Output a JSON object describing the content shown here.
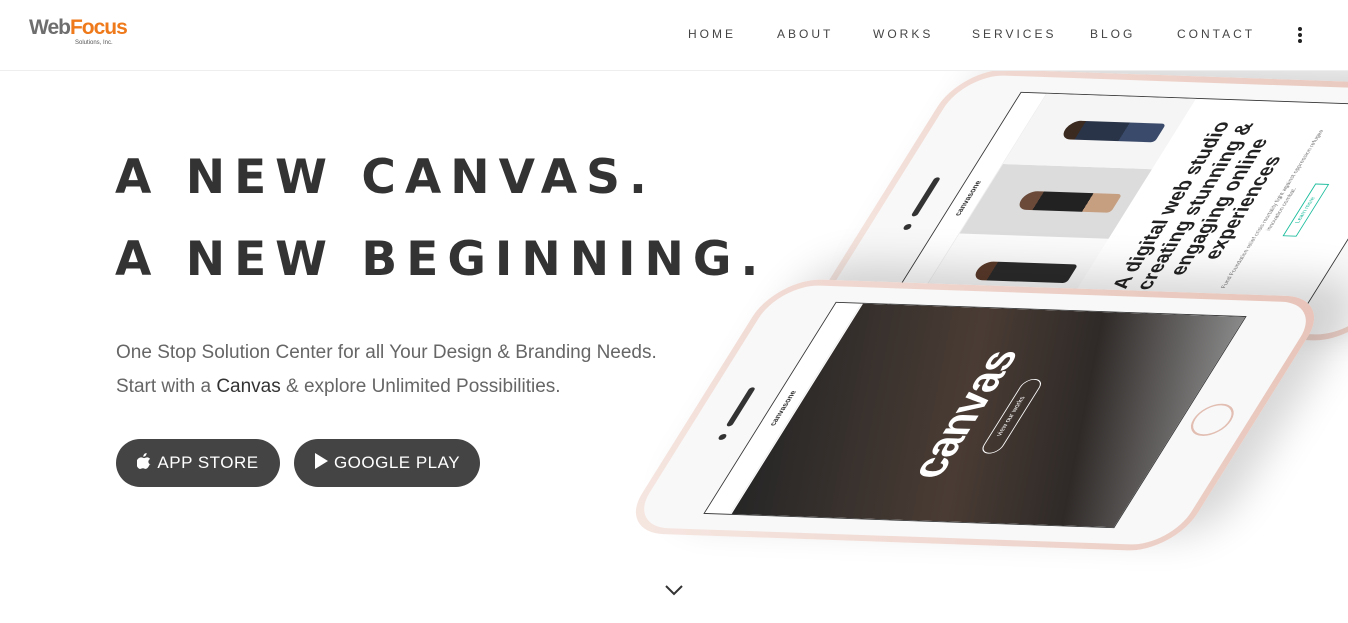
{
  "logo": {
    "word1": "Web",
    "word2": "Focus",
    "sub": "Solutions, Inc."
  },
  "nav": {
    "items": [
      {
        "label": "HOME"
      },
      {
        "label": "ABOUT"
      },
      {
        "label": "WORKS"
      },
      {
        "label": "SERVICES"
      },
      {
        "label": "BLOG"
      },
      {
        "label": "CONTACT"
      }
    ],
    "menu_icon": "kebab-vertical-icon"
  },
  "hero": {
    "headline_line1": "A NEW CANVAS.",
    "headline_line2": "A NEW BEGINNING.",
    "lede_part1": "One Stop Solution Center for all Your Design & Branding Needs. Start with a ",
    "lede_bold": "Canvas",
    "lede_part2": " & explore Unlimited Possibilities.",
    "buttons": {
      "app_store": {
        "label": "APP STORE",
        "icon": "apple-icon"
      },
      "google_play": {
        "label": "GOOGLE PLAY",
        "icon": "play-icon"
      }
    },
    "scroll_icon": "chevron-down-icon"
  },
  "mockup_back": {
    "brand": "canvasone",
    "tagline": "A digital web studio creating stunning & engaging online experiences",
    "copy": "Fund Foundation relief crisis mortality fight against oppression refugee innovation combat.",
    "link": "Learn more"
  },
  "mockup_front": {
    "brand": "canvasone",
    "hero_word": "canvas",
    "cta": "view our works"
  },
  "colors": {
    "button_bg": "#444444",
    "logo_grey": "#6e6e6e",
    "logo_orange": "#ee7a1b",
    "phone_rose": "#e7c3b8"
  }
}
